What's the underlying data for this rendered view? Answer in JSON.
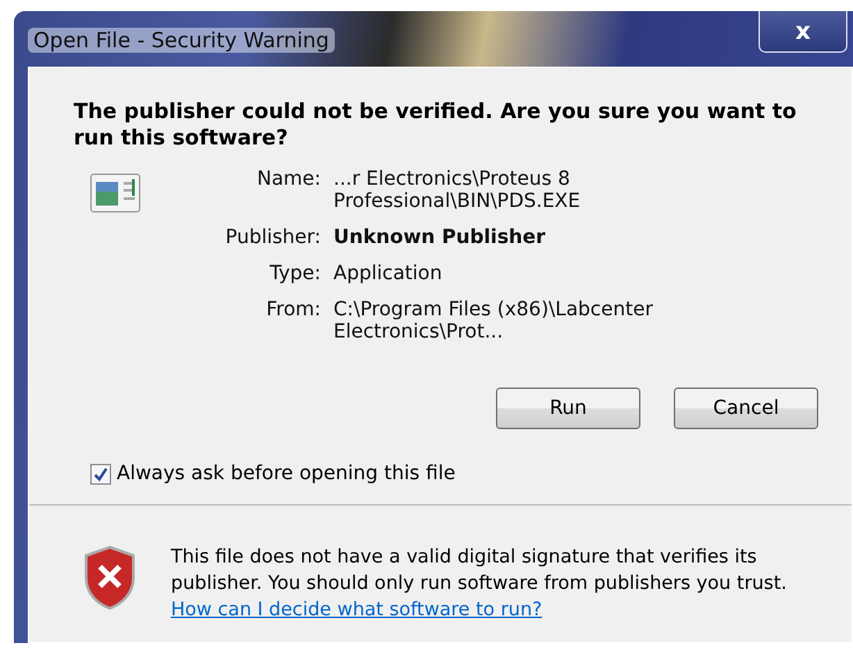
{
  "window": {
    "title": "Open File - Security Warning",
    "close_label": "x"
  },
  "heading": "The publisher could not be verified.  Are you sure you want to run this software?",
  "details": [
    {
      "label": "Name:",
      "value": "...r Electronics\\Proteus 8 Professional\\BIN\\PDS.EXE",
      "bold": false
    },
    {
      "label": "Publisher:",
      "value": "Unknown Publisher",
      "bold": true
    },
    {
      "label": "Type:",
      "value": "Application",
      "bold": false
    },
    {
      "label": "From:",
      "value": "C:\\Program Files (x86)\\Labcenter Electronics\\Prot...",
      "bold": false
    }
  ],
  "buttons": [
    "Run",
    "Cancel"
  ],
  "checkbox": {
    "label": "Always ask before opening this file",
    "checked": true
  },
  "footer": {
    "message": "This file does not have a valid digital signature that verifies its publisher.  You should only run software from publishers you trust.",
    "link": "How can I decide what software to run?"
  }
}
